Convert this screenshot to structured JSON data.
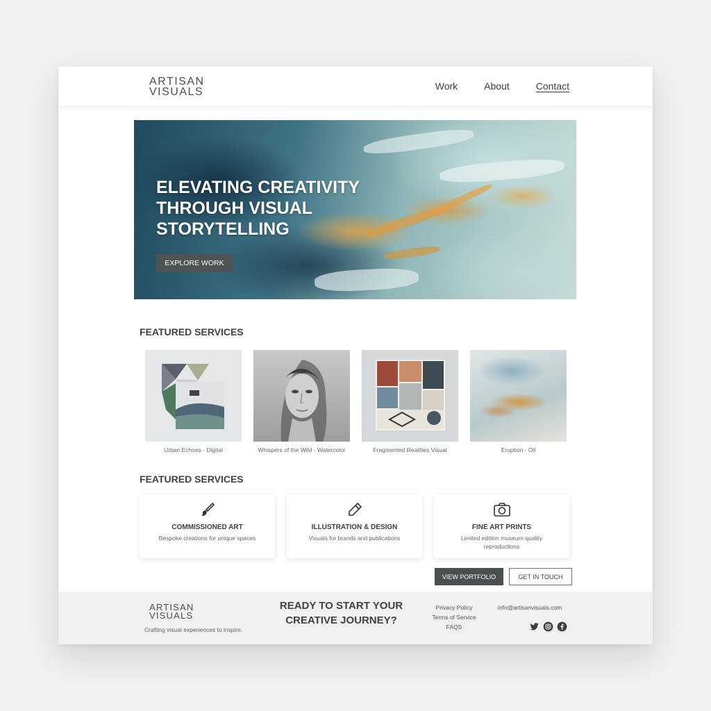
{
  "brand": {
    "line1": "ARTISAN",
    "line2": "VISUALS"
  },
  "nav": {
    "work": "Work",
    "about": "About",
    "contact": "Contact"
  },
  "hero": {
    "line1": "ELEVATING CREATIVITY",
    "line2": "THROUGH VISUAL",
    "line3": "STORYTELLING",
    "button": "EXPLORE WORK"
  },
  "gallery": {
    "title": "FEATURED SERVICES",
    "items": [
      {
        "caption": "Urban Echoes - Digital"
      },
      {
        "caption": "Whispers of the Wild - Watercolor"
      },
      {
        "caption": "Fragmented Realities Visual"
      },
      {
        "caption": "Eruption - Oil"
      }
    ]
  },
  "services": {
    "title": "FEATURED SERVICES",
    "items": [
      {
        "name": "COMMISSIONED ART",
        "desc": "Bespoke creations for unique spaces",
        "icon": "paintbrush-icon"
      },
      {
        "name": "ILLUSTRATION & DESIGN",
        "desc": "Visuals for brands and publications",
        "icon": "pencil-icon"
      },
      {
        "name": "FINE ART PRINTS",
        "desc": "Limited edition museum-quality reproductions",
        "icon": "camera-icon"
      }
    ]
  },
  "actions": {
    "portfolio": "VIEW PORTFOLIO",
    "contact": "GET IN TOUCH"
  },
  "footer": {
    "brand_line1": "ARTISAN",
    "brand_line2": "VISUALS",
    "tagline": "Crafting visual experiences to inspire.",
    "cta_line1": "READY TO START YOUR",
    "cta_line2": "CREATIVE JOURNEY?",
    "links": [
      "Privacy Policy",
      "Terms of Service",
      "FAQS"
    ],
    "email": "info@artisanvisuals.com",
    "social": [
      "twitter-icon",
      "instagram-icon",
      "facebook-icon"
    ]
  },
  "colors": {
    "accent_dark": "#4a4f52",
    "footer_bg": "#eef0f1",
    "hero_gold": "#d99a44",
    "hero_teal": "#3f7385"
  }
}
